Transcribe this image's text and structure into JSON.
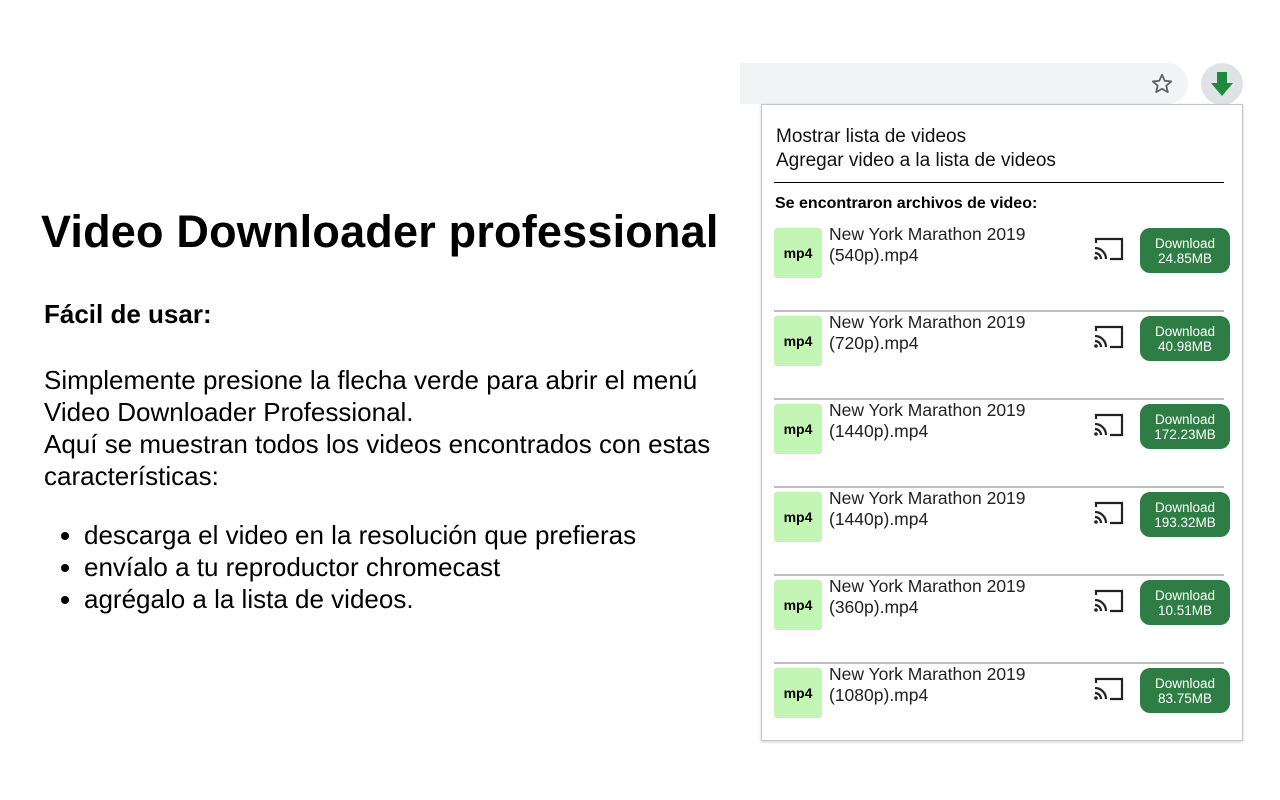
{
  "promo": {
    "title": "Video Downloader professional",
    "subtitle": "Fácil de usar:",
    "paragraph1": "Simplemente presione la flecha verde para abrir el menú Video Downloader Professional.",
    "paragraph2": "Aquí se muestran todos los videos encontrados con estas características:",
    "features": [
      "descarga el video en la resolución que prefieras",
      "envíalo a tu reproductor chromecast",
      "agrégalo a la lista de videos."
    ]
  },
  "toolbar": {
    "star_icon": "star-outline-icon",
    "extension_icon": "green-down-arrow-icon",
    "accent_color": "#1e8a3c"
  },
  "popup": {
    "menu": [
      "Mostrar lista de videos",
      "Agregar video a la lista de videos"
    ],
    "found_label": "Se encontraron archivos de video:",
    "videos": [
      {
        "format": "mp4",
        "name": "New York Marathon 2019 (540p).mp4",
        "download": "Download",
        "size": "24.85MB"
      },
      {
        "format": "mp4",
        "name": "New York Marathon 2019 (720p).mp4",
        "download": "Download",
        "size": "40.98MB"
      },
      {
        "format": "mp4",
        "name": "New York Marathon 2019 (1440p).mp4",
        "download": "Download",
        "size": "172.23MB"
      },
      {
        "format": "mp4",
        "name": "New York Marathon 2019 (1440p).mp4",
        "download": "Download",
        "size": "193.32MB"
      },
      {
        "format": "mp4",
        "name": "New York Marathon 2019 (360p).mp4",
        "download": "Download",
        "size": "10.51MB"
      },
      {
        "format": "mp4",
        "name": "New York Marathon 2019 (1080p).mp4",
        "download": "Download",
        "size": "83.75MB"
      }
    ],
    "download_color": "#2e7d44",
    "badge_color": "#c3f5b4"
  }
}
